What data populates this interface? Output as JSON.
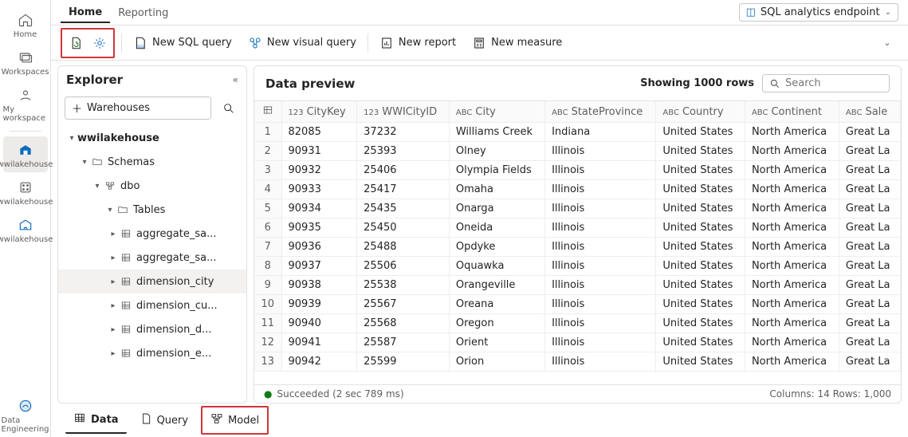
{
  "leftnav": {
    "items": [
      {
        "label": "Home",
        "icon": "home-icon"
      },
      {
        "label": "Workspaces",
        "icon": "workspaces-icon"
      },
      {
        "label": "My workspace",
        "icon": "my-workspace-icon"
      }
    ],
    "secondary": [
      {
        "label": "wwilakehouse",
        "icon": "lakehouse-icon"
      },
      {
        "label": "wwilakehouse",
        "icon": "semantic-model-icon"
      },
      {
        "label": "wwilakehouse",
        "icon": "sql-endpoint-icon"
      }
    ],
    "persona_label": "Data Engineering"
  },
  "top": {
    "tabs": [
      {
        "label": "Home"
      },
      {
        "label": "Reporting"
      }
    ],
    "endpoint_label": "SQL analytics endpoint"
  },
  "ribbon": {
    "new_sql": "New SQL query",
    "new_visual": "New visual query",
    "new_report": "New report",
    "new_measure": "New measure"
  },
  "explorer": {
    "title": "Explorer",
    "warehouses_label": "Warehouses",
    "tree": {
      "root": "wwilakehouse",
      "schemas": "Schemas",
      "dbo": "dbo",
      "tables_label": "Tables",
      "tables": [
        "aggregate_sa...",
        "aggregate_sa...",
        "dimension_city",
        "dimension_cu...",
        "dimension_d...",
        "dimension_e..."
      ]
    }
  },
  "datapane": {
    "title": "Data preview",
    "rowcount_label": "Showing 1000 rows",
    "search_placeholder": "Search",
    "columns": [
      {
        "prefix": "123",
        "label": "CityKey"
      },
      {
        "prefix": "123",
        "label": "WWICityID"
      },
      {
        "prefix": "ABC",
        "label": "City"
      },
      {
        "prefix": "ABC",
        "label": "StateProvince"
      },
      {
        "prefix": "ABC",
        "label": "Country"
      },
      {
        "prefix": "ABC",
        "label": "Continent"
      },
      {
        "prefix": "ABC",
        "label": "Sale"
      }
    ],
    "rows": [
      {
        "n": "1",
        "CityKey": "82085",
        "WWICityID": "37232",
        "City": "Williams Creek",
        "StateProvince": "Indiana",
        "Country": "United States",
        "Continent": "North America",
        "Sale": "Great La"
      },
      {
        "n": "2",
        "CityKey": "90931",
        "WWICityID": "25393",
        "City": "Olney",
        "StateProvince": "Illinois",
        "Country": "United States",
        "Continent": "North America",
        "Sale": "Great La"
      },
      {
        "n": "3",
        "CityKey": "90932",
        "WWICityID": "25406",
        "City": "Olympia Fields",
        "StateProvince": "Illinois",
        "Country": "United States",
        "Continent": "North America",
        "Sale": "Great La"
      },
      {
        "n": "4",
        "CityKey": "90933",
        "WWICityID": "25417",
        "City": "Omaha",
        "StateProvince": "Illinois",
        "Country": "United States",
        "Continent": "North America",
        "Sale": "Great La"
      },
      {
        "n": "5",
        "CityKey": "90934",
        "WWICityID": "25435",
        "City": "Onarga",
        "StateProvince": "Illinois",
        "Country": "United States",
        "Continent": "North America",
        "Sale": "Great La"
      },
      {
        "n": "6",
        "CityKey": "90935",
        "WWICityID": "25450",
        "City": "Oneida",
        "StateProvince": "Illinois",
        "Country": "United States",
        "Continent": "North America",
        "Sale": "Great La"
      },
      {
        "n": "7",
        "CityKey": "90936",
        "WWICityID": "25488",
        "City": "Opdyke",
        "StateProvince": "Illinois",
        "Country": "United States",
        "Continent": "North America",
        "Sale": "Great La"
      },
      {
        "n": "8",
        "CityKey": "90937",
        "WWICityID": "25506",
        "City": "Oquawka",
        "StateProvince": "Illinois",
        "Country": "United States",
        "Continent": "North America",
        "Sale": "Great La"
      },
      {
        "n": "9",
        "CityKey": "90938",
        "WWICityID": "25538",
        "City": "Orangeville",
        "StateProvince": "Illinois",
        "Country": "United States",
        "Continent": "North America",
        "Sale": "Great La"
      },
      {
        "n": "10",
        "CityKey": "90939",
        "WWICityID": "25567",
        "City": "Oreana",
        "StateProvince": "Illinois",
        "Country": "United States",
        "Continent": "North America",
        "Sale": "Great La"
      },
      {
        "n": "11",
        "CityKey": "90940",
        "WWICityID": "25568",
        "City": "Oregon",
        "StateProvince": "Illinois",
        "Country": "United States",
        "Continent": "North America",
        "Sale": "Great La"
      },
      {
        "n": "12",
        "CityKey": "90941",
        "WWICityID": "25587",
        "City": "Orient",
        "StateProvince": "Illinois",
        "Country": "United States",
        "Continent": "North America",
        "Sale": "Great La"
      },
      {
        "n": "13",
        "CityKey": "90942",
        "WWICityID": "25599",
        "City": "Orion",
        "StateProvince": "Illinois",
        "Country": "United States",
        "Continent": "North America",
        "Sale": "Great La"
      }
    ],
    "status_text": "Succeeded (2 sec 789 ms)",
    "status_meta": "Columns: 14  Rows: 1,000"
  },
  "footer": {
    "tabs": [
      {
        "label": "Data"
      },
      {
        "label": "Query"
      },
      {
        "label": "Model"
      }
    ]
  }
}
